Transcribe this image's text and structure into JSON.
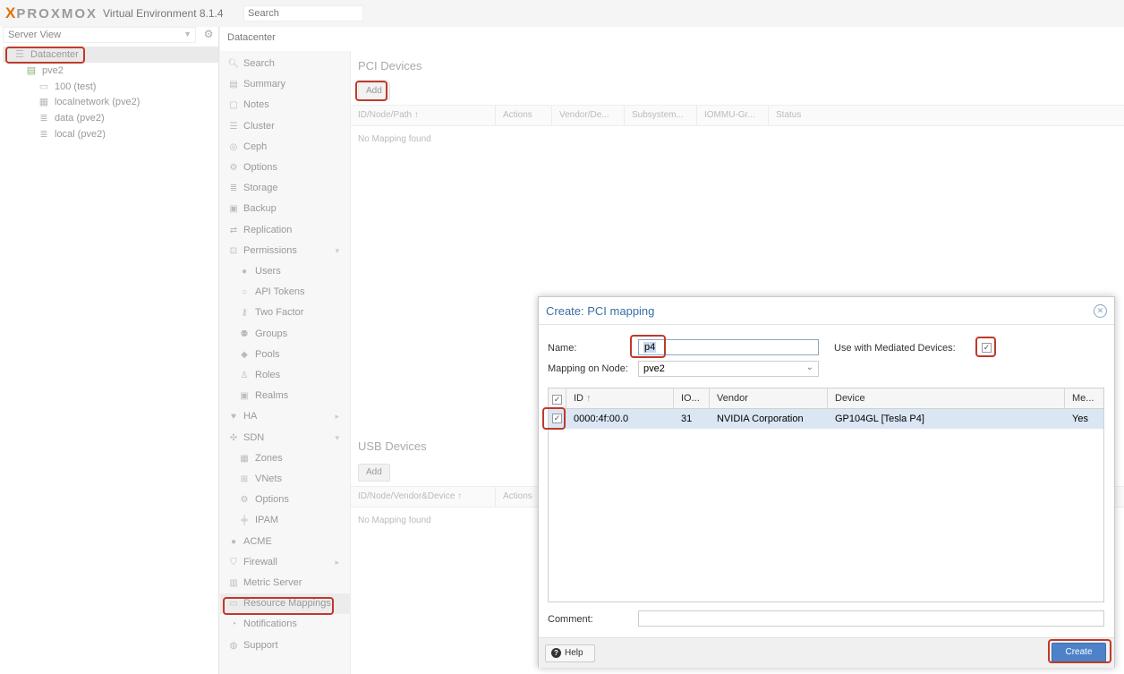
{
  "header": {
    "logo_mark": "X",
    "logo_word": "PROXMOX",
    "product": "Virtual Environment 8.1.4",
    "search_placeholder": "Search"
  },
  "tree": {
    "view_selector": "Server View",
    "nodes": [
      {
        "label": "Datacenter",
        "icon": "datacenter-icon"
      },
      {
        "label": "pve2",
        "icon": "node-icon"
      },
      {
        "label": "100 (test)",
        "icon": "vm-icon"
      },
      {
        "label": "localnetwork (pve2)",
        "icon": "network-icon"
      },
      {
        "label": "data (pve2)",
        "icon": "storage-icon"
      },
      {
        "label": "local (pve2)",
        "icon": "storage-icon"
      }
    ]
  },
  "breadcrumb": "Datacenter",
  "menu": {
    "items": [
      {
        "label": "Search",
        "icon": "search-icon"
      },
      {
        "label": "Summary",
        "icon": "book-icon"
      },
      {
        "label": "Notes",
        "icon": "note-icon"
      },
      {
        "label": "Cluster",
        "icon": "server-icon"
      },
      {
        "label": "Ceph",
        "icon": "ceph-icon"
      },
      {
        "label": "Options",
        "icon": "gear-icon"
      },
      {
        "label": "Storage",
        "icon": "database-icon"
      },
      {
        "label": "Backup",
        "icon": "floppy-icon"
      },
      {
        "label": "Replication",
        "icon": "retweet-icon"
      },
      {
        "label": "Permissions",
        "icon": "unlock-icon"
      },
      {
        "label": "Users",
        "icon": "user-icon"
      },
      {
        "label": "API Tokens",
        "icon": "user-outline-icon"
      },
      {
        "label": "Two Factor",
        "icon": "key-icon"
      },
      {
        "label": "Groups",
        "icon": "users-icon"
      },
      {
        "label": "Pools",
        "icon": "tags-icon"
      },
      {
        "label": "Roles",
        "icon": "male-icon"
      },
      {
        "label": "Realms",
        "icon": "address-book-icon"
      },
      {
        "label": "HA",
        "icon": "heartbeat-icon"
      },
      {
        "label": "SDN",
        "icon": "sdn-icon"
      },
      {
        "label": "Zones",
        "icon": "th-icon"
      },
      {
        "label": "VNets",
        "icon": "sitemap-icon"
      },
      {
        "label": "Options",
        "icon": "gear-icon"
      },
      {
        "label": "IPAM",
        "icon": "ipam-icon"
      },
      {
        "label": "ACME",
        "icon": "certificate-icon"
      },
      {
        "label": "Firewall",
        "icon": "shield-icon"
      },
      {
        "label": "Metric Server",
        "icon": "bar-chart-icon"
      },
      {
        "label": "Resource Mappings",
        "icon": "folder-icon"
      },
      {
        "label": "Notifications",
        "icon": "bell-icon"
      },
      {
        "label": "Support",
        "icon": "comments-icon"
      }
    ]
  },
  "pci": {
    "title": "PCI Devices",
    "add_label": "Add",
    "columns": [
      "ID/Node/Path",
      "Actions",
      "Vendor/De...",
      "Subsystem...",
      "IOMMU-Gr...",
      "Status"
    ],
    "empty_text": "No Mapping found"
  },
  "usb": {
    "title": "USB Devices",
    "add_label": "Add",
    "columns": [
      "ID/Node/Vendor&Device",
      "Actions"
    ],
    "empty_text": "No Mapping found"
  },
  "dialog": {
    "title": "Create: PCI mapping",
    "name_label": "Name:",
    "name_value": "p4",
    "mediated_label": "Use with Mediated Devices:",
    "mediated_checked": true,
    "node_label": "Mapping on Node:",
    "node_value": "pve2",
    "grid": {
      "columns": [
        "ID",
        "IO...",
        "Vendor",
        "Device",
        "Me..."
      ],
      "rows": [
        {
          "id": "0000:4f:00.0",
          "iommu": "31",
          "vendor": "NVIDIA Corporation",
          "device": "GP104GL [Tesla P4]",
          "mdev": "Yes",
          "checked": true
        }
      ]
    },
    "comment_label": "Comment:",
    "comment_value": "",
    "help_label": "Help",
    "create_label": "Create"
  }
}
